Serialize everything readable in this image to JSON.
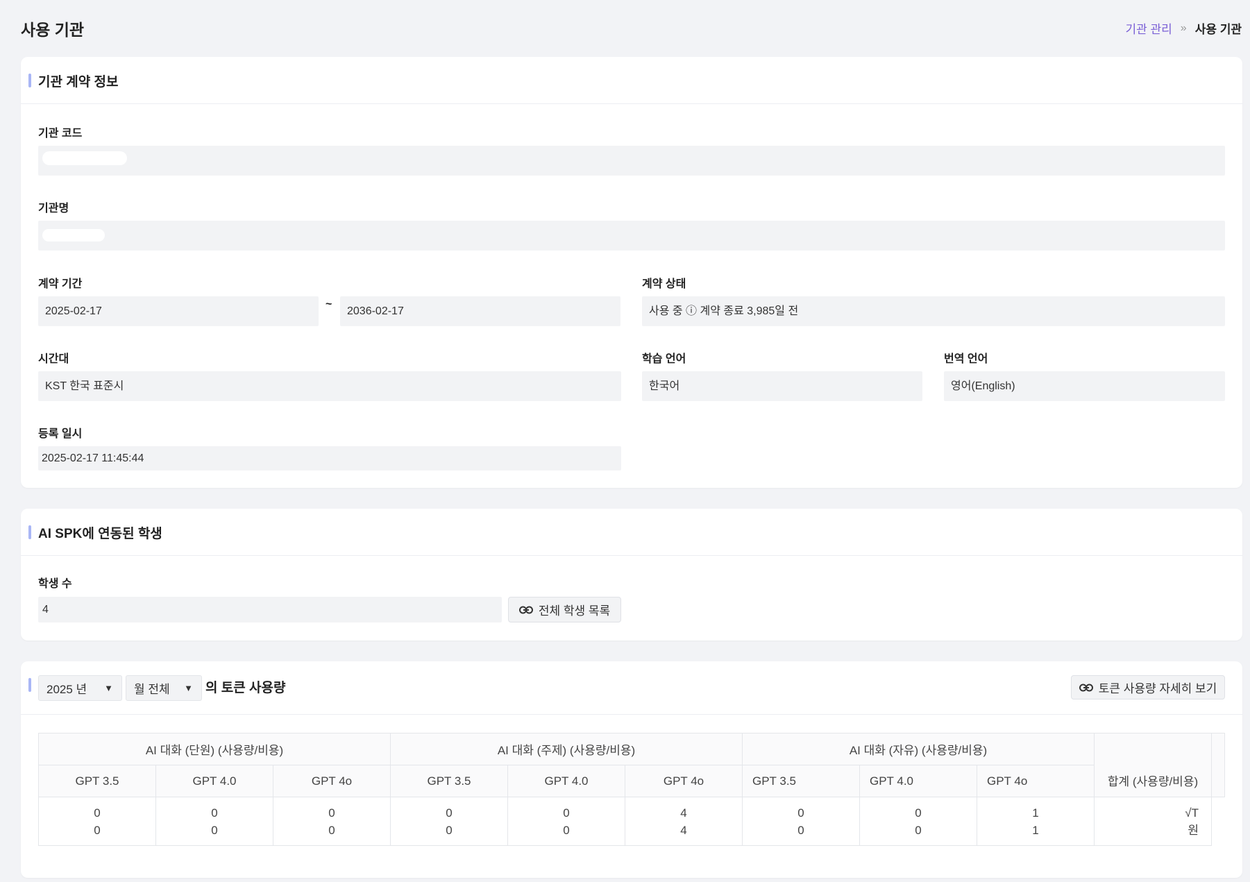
{
  "page": {
    "title": "사용 기관"
  },
  "breadcrumb": {
    "parent": "기관 관리",
    "separator": "»",
    "current": "사용 기관"
  },
  "contract": {
    "section_title": "기관 계약 정보",
    "code_label": "기관 코드",
    "name_label": "기관명",
    "period_label": "계약 기간",
    "period_start": "2025-02-17",
    "period_sep": "~",
    "period_end": "2036-02-17",
    "status_label": "계약 상태",
    "status_value": "사용 중 ⓘ 계약 종료 3,985일 전",
    "timezone_label": "시간대",
    "timezone_value": "KST 한국 표준시",
    "learn_lang_label": "학습 언어",
    "learn_lang_value": "한국어",
    "trans_lang_label": "번역 언어",
    "trans_lang_value": "영어(English)",
    "registered_label": "등록 일시",
    "registered_value": "2025-02-17 11:45:44"
  },
  "students": {
    "section_title": "AI SPK에 연동된 학생",
    "count_label": "학생 수",
    "count_value": "4",
    "list_button": "전체 학생 목록",
    "list_button_icon": "link-icon"
  },
  "usage": {
    "year_select": "2025 년",
    "month_select": "월 전체",
    "title_suffix": "의 토큰 사용량",
    "detail_button": "토큰 사용량 자세히 보기",
    "groups": [
      "AI 대화 (단원) (사용량/비용)",
      "AI 대화 (주제) (사용량/비용)",
      "AI 대화 (자유) (사용량/비용)"
    ],
    "models": [
      "GPT 3.5",
      "GPT 4.0",
      "GPT 4o"
    ],
    "total_header": "합계 (사용량/비용)",
    "usage_row": [
      "0",
      "0",
      "0",
      "0",
      "0",
      "4",
      "0",
      "0",
      "1"
    ],
    "cost_row": [
      "0",
      "0",
      "0",
      "0",
      "0",
      "4",
      "0",
      "0",
      "1"
    ],
    "total_usage": "√T",
    "total_cost": "원"
  }
}
